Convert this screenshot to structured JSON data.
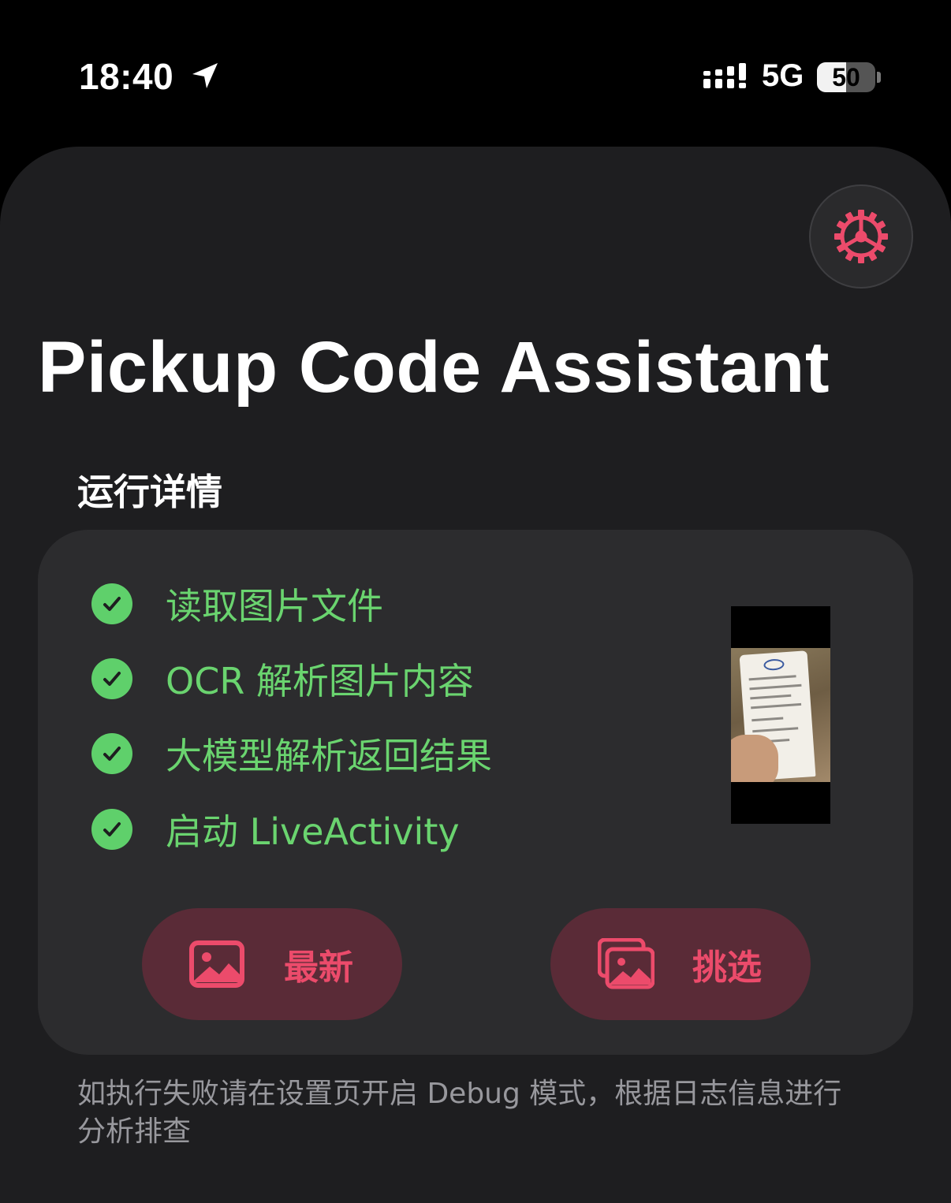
{
  "status_bar": {
    "time": "18:40",
    "network": "5G",
    "battery_percent": "50",
    "battery_level": 0.5,
    "icons": [
      "location-arrow-icon",
      "signal-bars-icon",
      "battery-icon"
    ]
  },
  "header": {
    "title": "Pickup Code Assistant",
    "settings_icon": "gear-icon"
  },
  "run_details": {
    "heading": "运行详情",
    "steps": [
      {
        "label": "读取图片文件",
        "status": "done"
      },
      {
        "label": "OCR 解析图片内容",
        "status": "done"
      },
      {
        "label": "大模型解析返回结果",
        "status": "done"
      },
      {
        "label": "启动 LiveActivity",
        "status": "done"
      }
    ],
    "thumbnail_icon": "receipt-photo-thumbnail"
  },
  "actions": {
    "latest_label": "最新",
    "latest_icon": "photo-icon",
    "pick_label": "挑选",
    "pick_icon": "photo-stack-icon"
  },
  "footnote": "如执行失败请在设置页开启 Debug 模式，根据日志信息进行分析排查",
  "colors": {
    "accent_red": "#ec4b6b",
    "button_bg": "#5a2b37",
    "success_green": "#6ad46f",
    "card_bg": "#2c2c2e",
    "sheet_bg": "#1e1e20"
  }
}
